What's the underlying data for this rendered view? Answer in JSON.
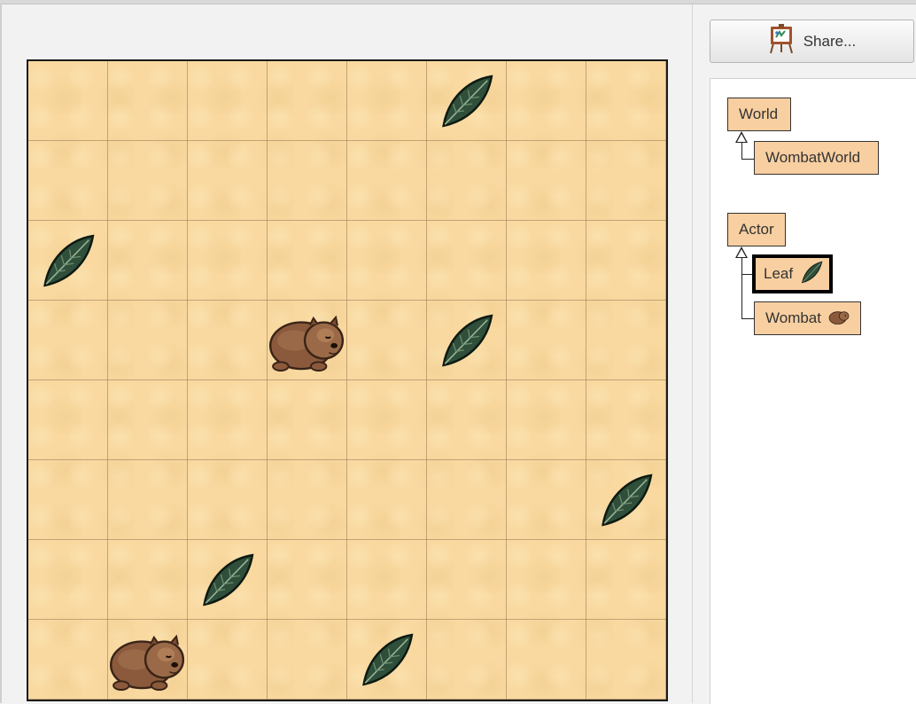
{
  "window": {
    "title": ""
  },
  "share_button": {
    "label": "Share...",
    "icon": "easel-share-icon"
  },
  "world": {
    "name": "WombatWorld",
    "grid": {
      "columns": 8,
      "rows": 8
    },
    "actors": [
      {
        "type": "leaf",
        "col": 5,
        "row": 0
      },
      {
        "type": "leaf",
        "col": 0,
        "row": 2
      },
      {
        "type": "wombat",
        "col": 3,
        "row": 3
      },
      {
        "type": "leaf",
        "col": 5,
        "row": 3
      },
      {
        "type": "leaf",
        "col": 7,
        "row": 5
      },
      {
        "type": "leaf",
        "col": 2,
        "row": 6
      },
      {
        "type": "wombat",
        "col": 1,
        "row": 7
      },
      {
        "type": "leaf",
        "col": 4,
        "row": 7
      }
    ]
  },
  "class_diagram": {
    "world_classes": [
      {
        "name": "World"
      },
      {
        "name": "WombatWorld"
      }
    ],
    "actor_classes": [
      {
        "name": "Actor"
      },
      {
        "name": "Leaf",
        "icon": "leaf-icon",
        "selected": true
      },
      {
        "name": "Wombat",
        "icon": "wombat-icon"
      }
    ]
  },
  "colors": {
    "world_background": "#f9d9a0",
    "class_box": "#f8cfa0",
    "leaf": "#2f4f3a",
    "wombat": "#8b5a3c"
  }
}
